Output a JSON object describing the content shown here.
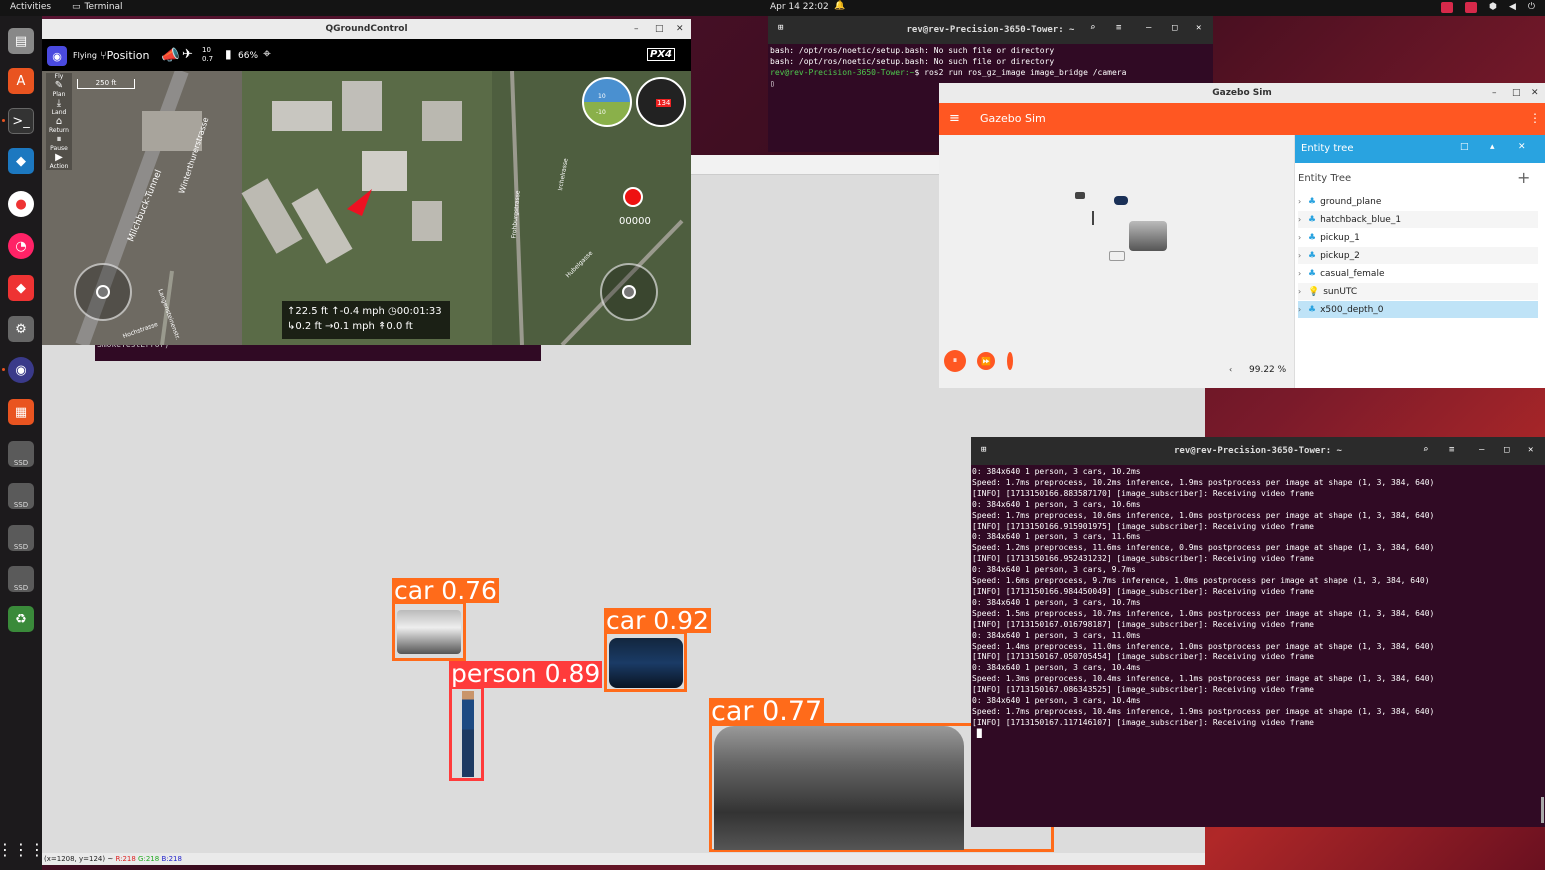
{
  "topbar": {
    "activities": "Activities",
    "terminal": "Terminal",
    "clock": "Apr 14  22:02"
  },
  "qgc": {
    "title": "QGroundControl",
    "flight_state": "Flying",
    "mode": "Position",
    "sats": "10",
    "hdop": "0.7",
    "battery": "66%",
    "logo": "PX4",
    "scale": "250 ft",
    "tools": [
      "Fly",
      "Plan",
      "Land",
      "Return",
      "Pause",
      "Action"
    ],
    "record_counter": "00000",
    "compass_value": "134",
    "att_top": "10",
    "att_bottom": "-10",
    "telemetry": {
      "altitude": "22.5 ft",
      "vert_speed": "-0.4 mph",
      "flight_time": "00:01:33",
      "dist_home": "0.2 ft",
      "horiz_speed": "0.1 mph",
      "alt2": "0.0 ft"
    },
    "map_labels": [
      "Milchbuck-Tunnel",
      "Winterthurerstrasse",
      "Frohburgstrasse",
      "Langensteinenstr.",
      "Hubelgasse",
      "Irchelrasse",
      "Hochstrasse"
    ]
  },
  "term1": {
    "title": "rev@rev-Precision-3650-Tower: ~",
    "lines": [
      "bash: /opt/ros/noetic/setup.bash: No such file or directory",
      "bash: /opt/ros/noetic/setup.bash: No such file or directory"
    ],
    "prompt": "rev@rev-Precision-3650-Tower:~",
    "command": "$ ros2 run ros_gz_image image_bridge /camera",
    "partial_visible": "SmokeTestError)"
  },
  "gazebo": {
    "title": "Gazebo Sim",
    "app_title": "Gazebo Sim",
    "panel_title": "Entity tree",
    "tree_header": "Entity Tree",
    "entities": [
      "ground_plane",
      "hatchback_blue_1",
      "pickup_1",
      "pickup_2",
      "casual_female",
      "sunUTC",
      "x500_depth_0"
    ],
    "rtf": "99.22 %"
  },
  "detections": [
    {
      "label": "car 0.76"
    },
    {
      "label": "car 0.92"
    },
    {
      "label": "person 0.89"
    },
    {
      "label": "car 0.77"
    }
  ],
  "image_status": {
    "coords": "(x=1208, y=124) ~",
    "r": "R:218",
    "g": "G:218",
    "b": "B:218"
  },
  "term2": {
    "title": "rev@rev-Precision-3650-Tower: ~",
    "lines": [
      "0: 384x640 1 person, 3 cars, 10.2ms",
      "Speed: 1.7ms preprocess, 10.2ms inference, 1.9ms postprocess per image at shape (1, 3, 384, 640)",
      "[INFO] [1713150166.883587170] [image_subscriber]: Receiving video frame",
      "",
      "0: 384x640 1 person, 3 cars, 10.6ms",
      "Speed: 1.7ms preprocess, 10.6ms inference, 1.0ms postprocess per image at shape (1, 3, 384, 640)",
      "[INFO] [1713150166.915901975] [image_subscriber]: Receiving video frame",
      "",
      "0: 384x640 1 person, 3 cars, 11.6ms",
      "Speed: 1.2ms preprocess, 11.6ms inference, 0.9ms postprocess per image at shape (1, 3, 384, 640)",
      "[INFO] [1713150166.952431232] [image_subscriber]: Receiving video frame",
      "",
      "0: 384x640 1 person, 3 cars, 9.7ms",
      "Speed: 1.6ms preprocess, 9.7ms inference, 1.0ms postprocess per image at shape (1, 3, 384, 640)",
      "[INFO] [1713150166.984450049] [image_subscriber]: Receiving video frame",
      "",
      "0: 384x640 1 person, 3 cars, 10.7ms",
      "Speed: 1.5ms preprocess, 10.7ms inference, 1.0ms postprocess per image at shape (1, 3, 384, 640)",
      "[INFO] [1713150167.016798187] [image_subscriber]: Receiving video frame",
      "",
      "0: 384x640 1 person, 3 cars, 11.0ms",
      "Speed: 1.4ms preprocess, 11.0ms inference, 1.0ms postprocess per image at shape (1, 3, 384, 640)",
      "[INFO] [1713150167.050705454] [image_subscriber]: Receiving video frame",
      "",
      "0: 384x640 1 person, 3 cars, 10.4ms",
      "Speed: 1.3ms preprocess, 10.4ms inference, 1.1ms postprocess per image at shape (1, 3, 384, 640)",
      "[INFO] [1713150167.086343525] [image_subscriber]: Receiving video frame",
      "",
      "0: 384x640 1 person, 3 cars, 10.4ms",
      "Speed: 1.7ms preprocess, 10.4ms inference, 1.9ms postprocess per image at shape (1, 3, 384, 640)",
      "[INFO] [1713150167.117146107] [image_subscriber]: Receiving video frame"
    ]
  },
  "dock": {
    "ssd_label": "SSD"
  },
  "colors": {
    "ubuntu_orange": "#e95420",
    "gazebo_orange": "#ff5722",
    "entity_blue": "#29a3e0",
    "det_orange": "#ff6b1a",
    "det_red": "#ff3b3b"
  }
}
